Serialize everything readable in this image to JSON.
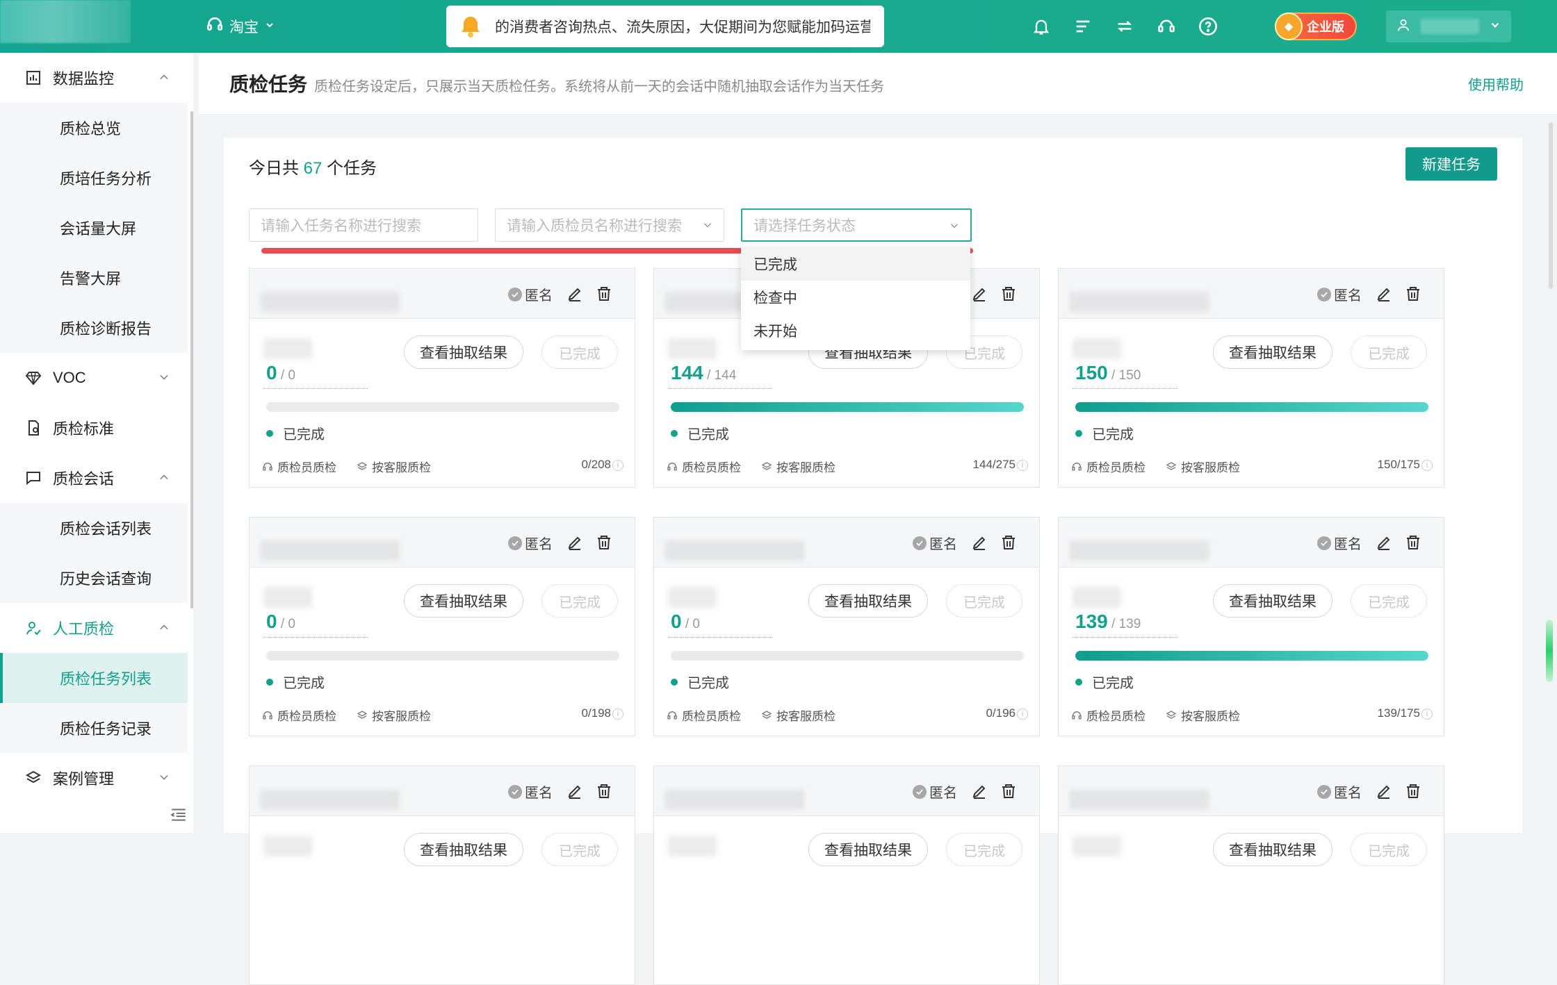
{
  "topbar": {
    "platform": "淘宝",
    "notice": "的消费者咨询热点、流失原因，大促期间为您赋能加码运营",
    "enterprise_badge": "企业版"
  },
  "sidebar": {
    "items": [
      {
        "label": "数据监控",
        "type": "parent",
        "expanded": true
      },
      {
        "label": "质检总览",
        "type": "child"
      },
      {
        "label": "质培任务分析",
        "type": "child"
      },
      {
        "label": "会话量大屏",
        "type": "child"
      },
      {
        "label": "告警大屏",
        "type": "child"
      },
      {
        "label": "质检诊断报告",
        "type": "child"
      },
      {
        "label": "VOC",
        "type": "parent",
        "expanded": false
      },
      {
        "label": "质检标准",
        "type": "parent"
      },
      {
        "label": "质检会话",
        "type": "parent",
        "expanded": true
      },
      {
        "label": "质检会话列表",
        "type": "child"
      },
      {
        "label": "历史会话查询",
        "type": "child"
      },
      {
        "label": "人工质检",
        "type": "parent",
        "expanded": true,
        "active": true
      },
      {
        "label": "质检任务列表",
        "type": "child",
        "active": true
      },
      {
        "label": "质检任务记录",
        "type": "child"
      },
      {
        "label": "案例管理",
        "type": "parent",
        "expanded": false
      }
    ]
  },
  "header": {
    "title": "质检任务",
    "desc": "质检任务设定后，只展示当天质检任务。系统将从前一天的会话中随机抽取会话作为当天任务",
    "help": "使用帮助"
  },
  "main": {
    "count_prefix": "今日共",
    "count": "67",
    "count_suffix": "个任务",
    "new_task": "新建任务",
    "search_task_placeholder": "请输入任务名称进行搜索",
    "search_inspector_placeholder": "请输入质检员名称进行搜索",
    "status_placeholder": "请选择任务状态",
    "status_options": [
      "已完成",
      "检查中",
      "未开始"
    ]
  },
  "card_labels": {
    "anon": "匿名",
    "view_result": "查看抽取结果",
    "done_btn": "已完成",
    "status": "已完成",
    "inspector": "质检员质检",
    "by_agent": "按客服质检"
  },
  "cards": [
    {
      "done": "0",
      "total": "0",
      "ratio": "0/208",
      "progress": 0
    },
    {
      "done": "144",
      "total": "144",
      "ratio": "144/275",
      "progress": 1
    },
    {
      "done": "150",
      "total": "150",
      "ratio": "150/175",
      "progress": 1
    },
    {
      "done": "0",
      "total": "0",
      "ratio": "0/198",
      "progress": 0
    },
    {
      "done": "0",
      "total": "0",
      "ratio": "0/196",
      "progress": 0
    },
    {
      "done": "139",
      "total": "139",
      "ratio": "139/175",
      "progress": 1
    },
    {},
    {},
    {}
  ],
  "colors": {
    "accent": "#13a08c",
    "topbar": "#16a78f",
    "highlight": "#e94c50"
  }
}
